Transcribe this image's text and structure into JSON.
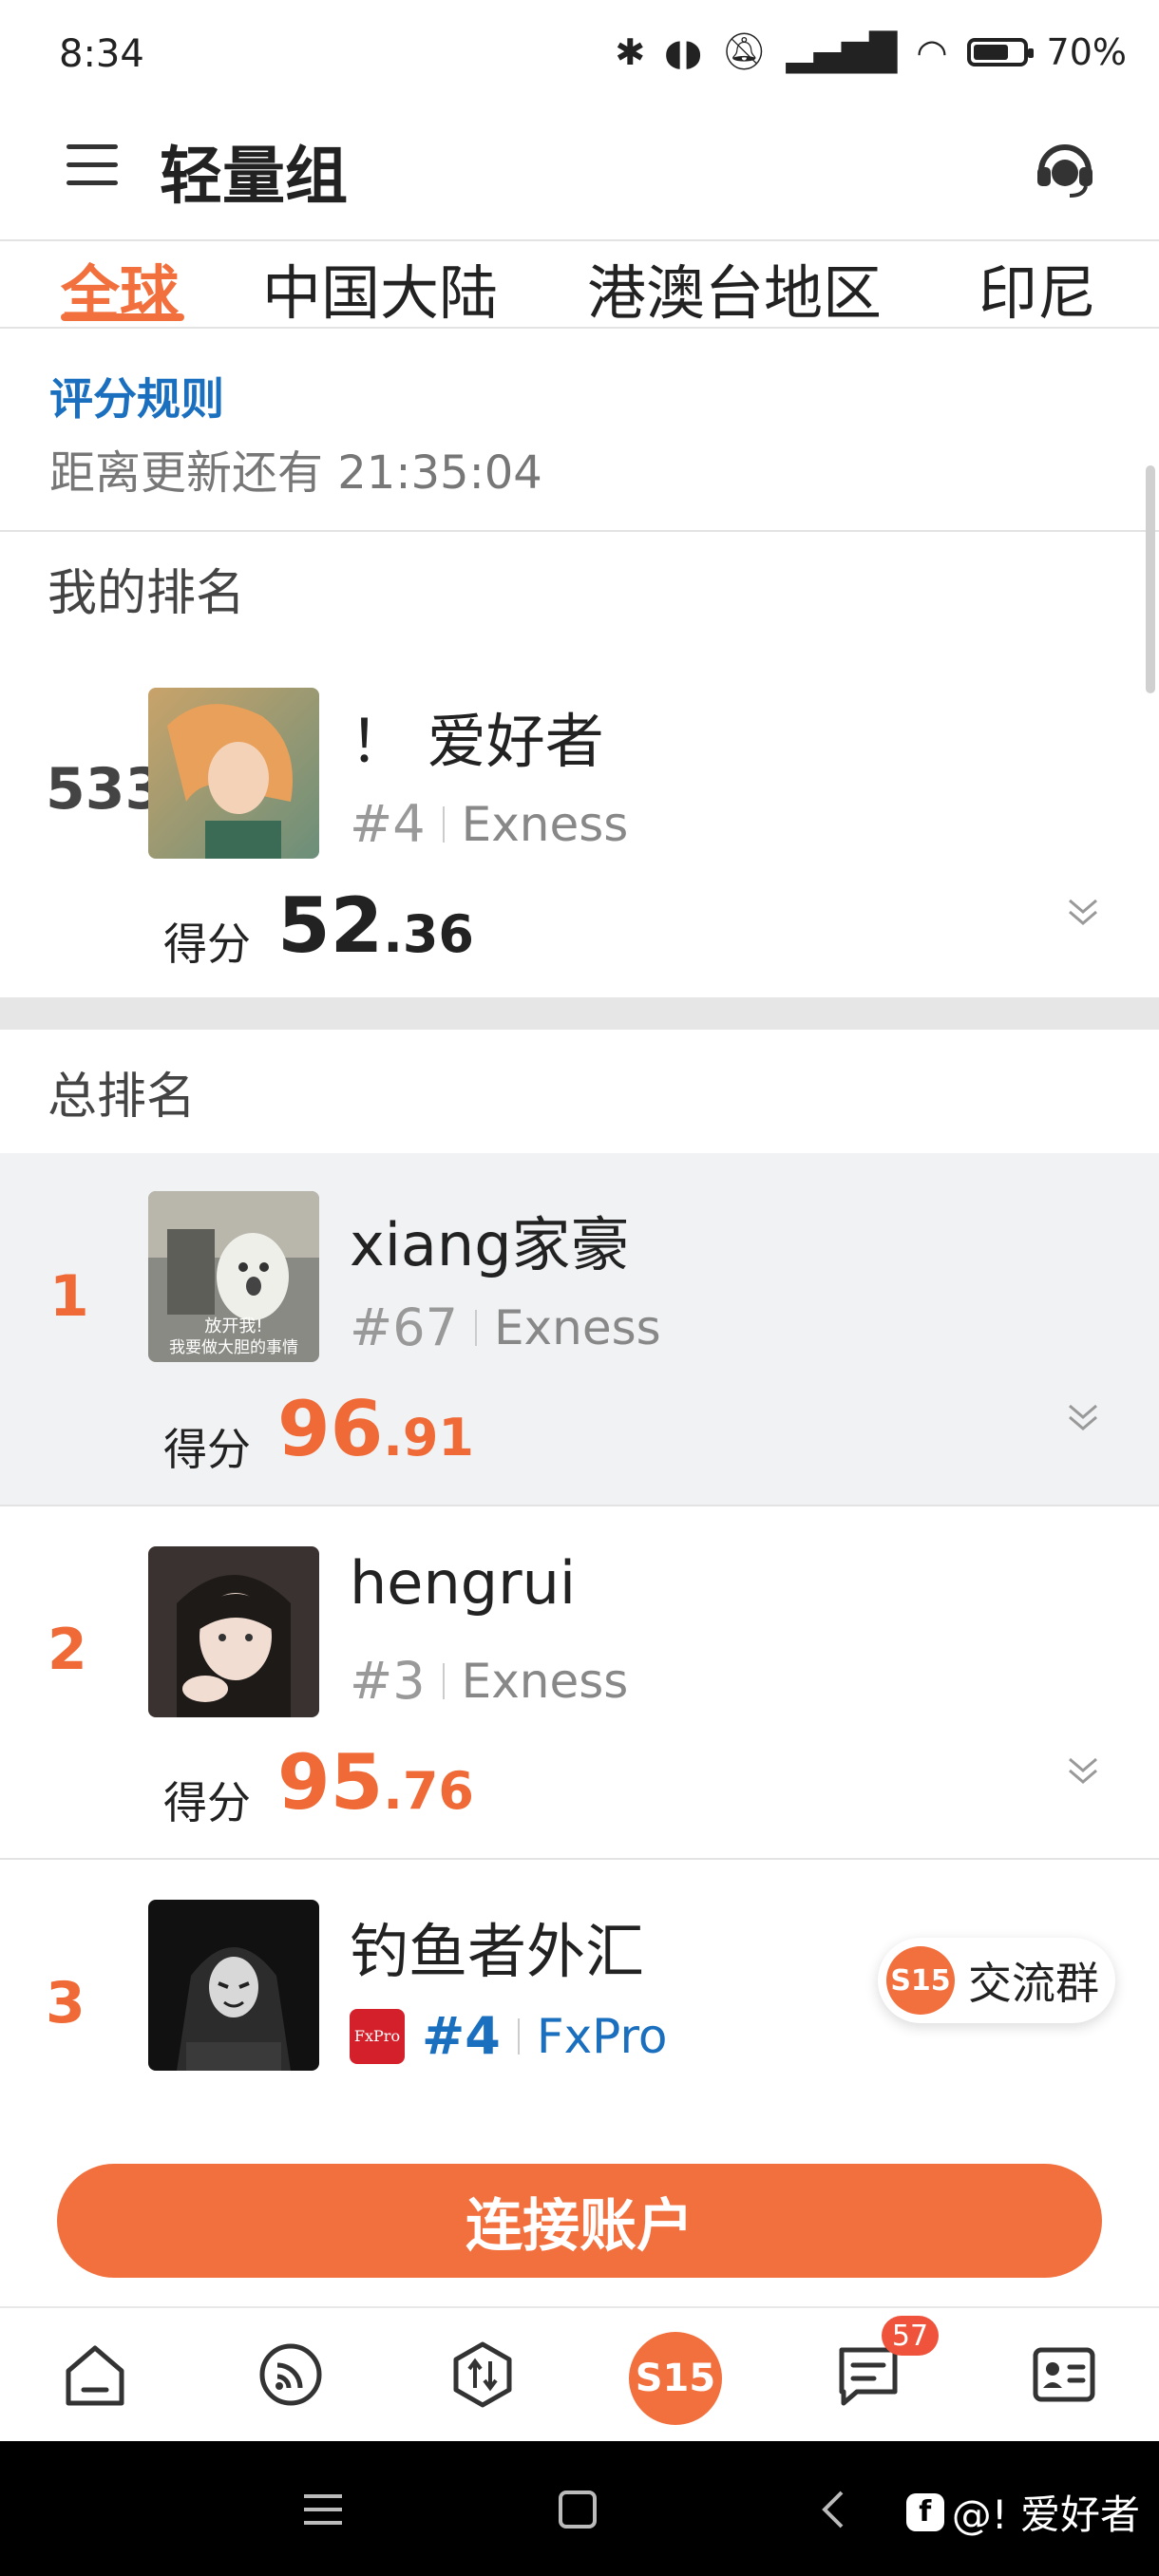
{
  "status_bar": {
    "time": "8:34",
    "battery": "70%",
    "battery_level": 0.7
  },
  "header": {
    "title": "轻量组"
  },
  "tabs": [
    {
      "label": "全球",
      "active": true
    },
    {
      "label": "中国大陆",
      "active": false
    },
    {
      "label": "港澳台地区",
      "active": false
    },
    {
      "label": "印尼",
      "active": false
    }
  ],
  "info": {
    "rules_link": "评分规则",
    "countdown": "距离更新还有 21:35:04"
  },
  "my_ranking": {
    "section_title": "我的排名",
    "rank": "533",
    "name": "！ 爱好者",
    "number": "#4",
    "broker": "Exness",
    "score_label": "得分",
    "score_int": "52",
    "score_dec": ".36"
  },
  "total_ranking": {
    "section_title": "总排名",
    "rows": [
      {
        "rank": "1",
        "name": "xiang家豪",
        "number": "#67",
        "broker": "Exness",
        "score_label": "得分",
        "score_int": "96",
        "score_dec": ".91",
        "avatar_caption_1": "放开我!",
        "avatar_caption_2": "我要做大胆的事情"
      },
      {
        "rank": "2",
        "name": "hengrui",
        "number": "#3",
        "broker": "Exness",
        "score_label": "得分",
        "score_int": "95",
        "score_dec": ".76"
      },
      {
        "rank": "3",
        "name": "钓鱼者外汇",
        "number": "#4",
        "broker": "FxPro",
        "broker_logo": "FxPro"
      }
    ]
  },
  "chat_chip": {
    "badge": "S15",
    "label": "交流群"
  },
  "connect_button": "连接账户",
  "bottom_nav": {
    "center_label": "S15",
    "message_badge": "57"
  },
  "watermark": {
    "text": "@!  爱好者"
  },
  "colors": {
    "accent": "#f2703d",
    "link": "#1a6fbf",
    "badge": "#f0533b"
  }
}
